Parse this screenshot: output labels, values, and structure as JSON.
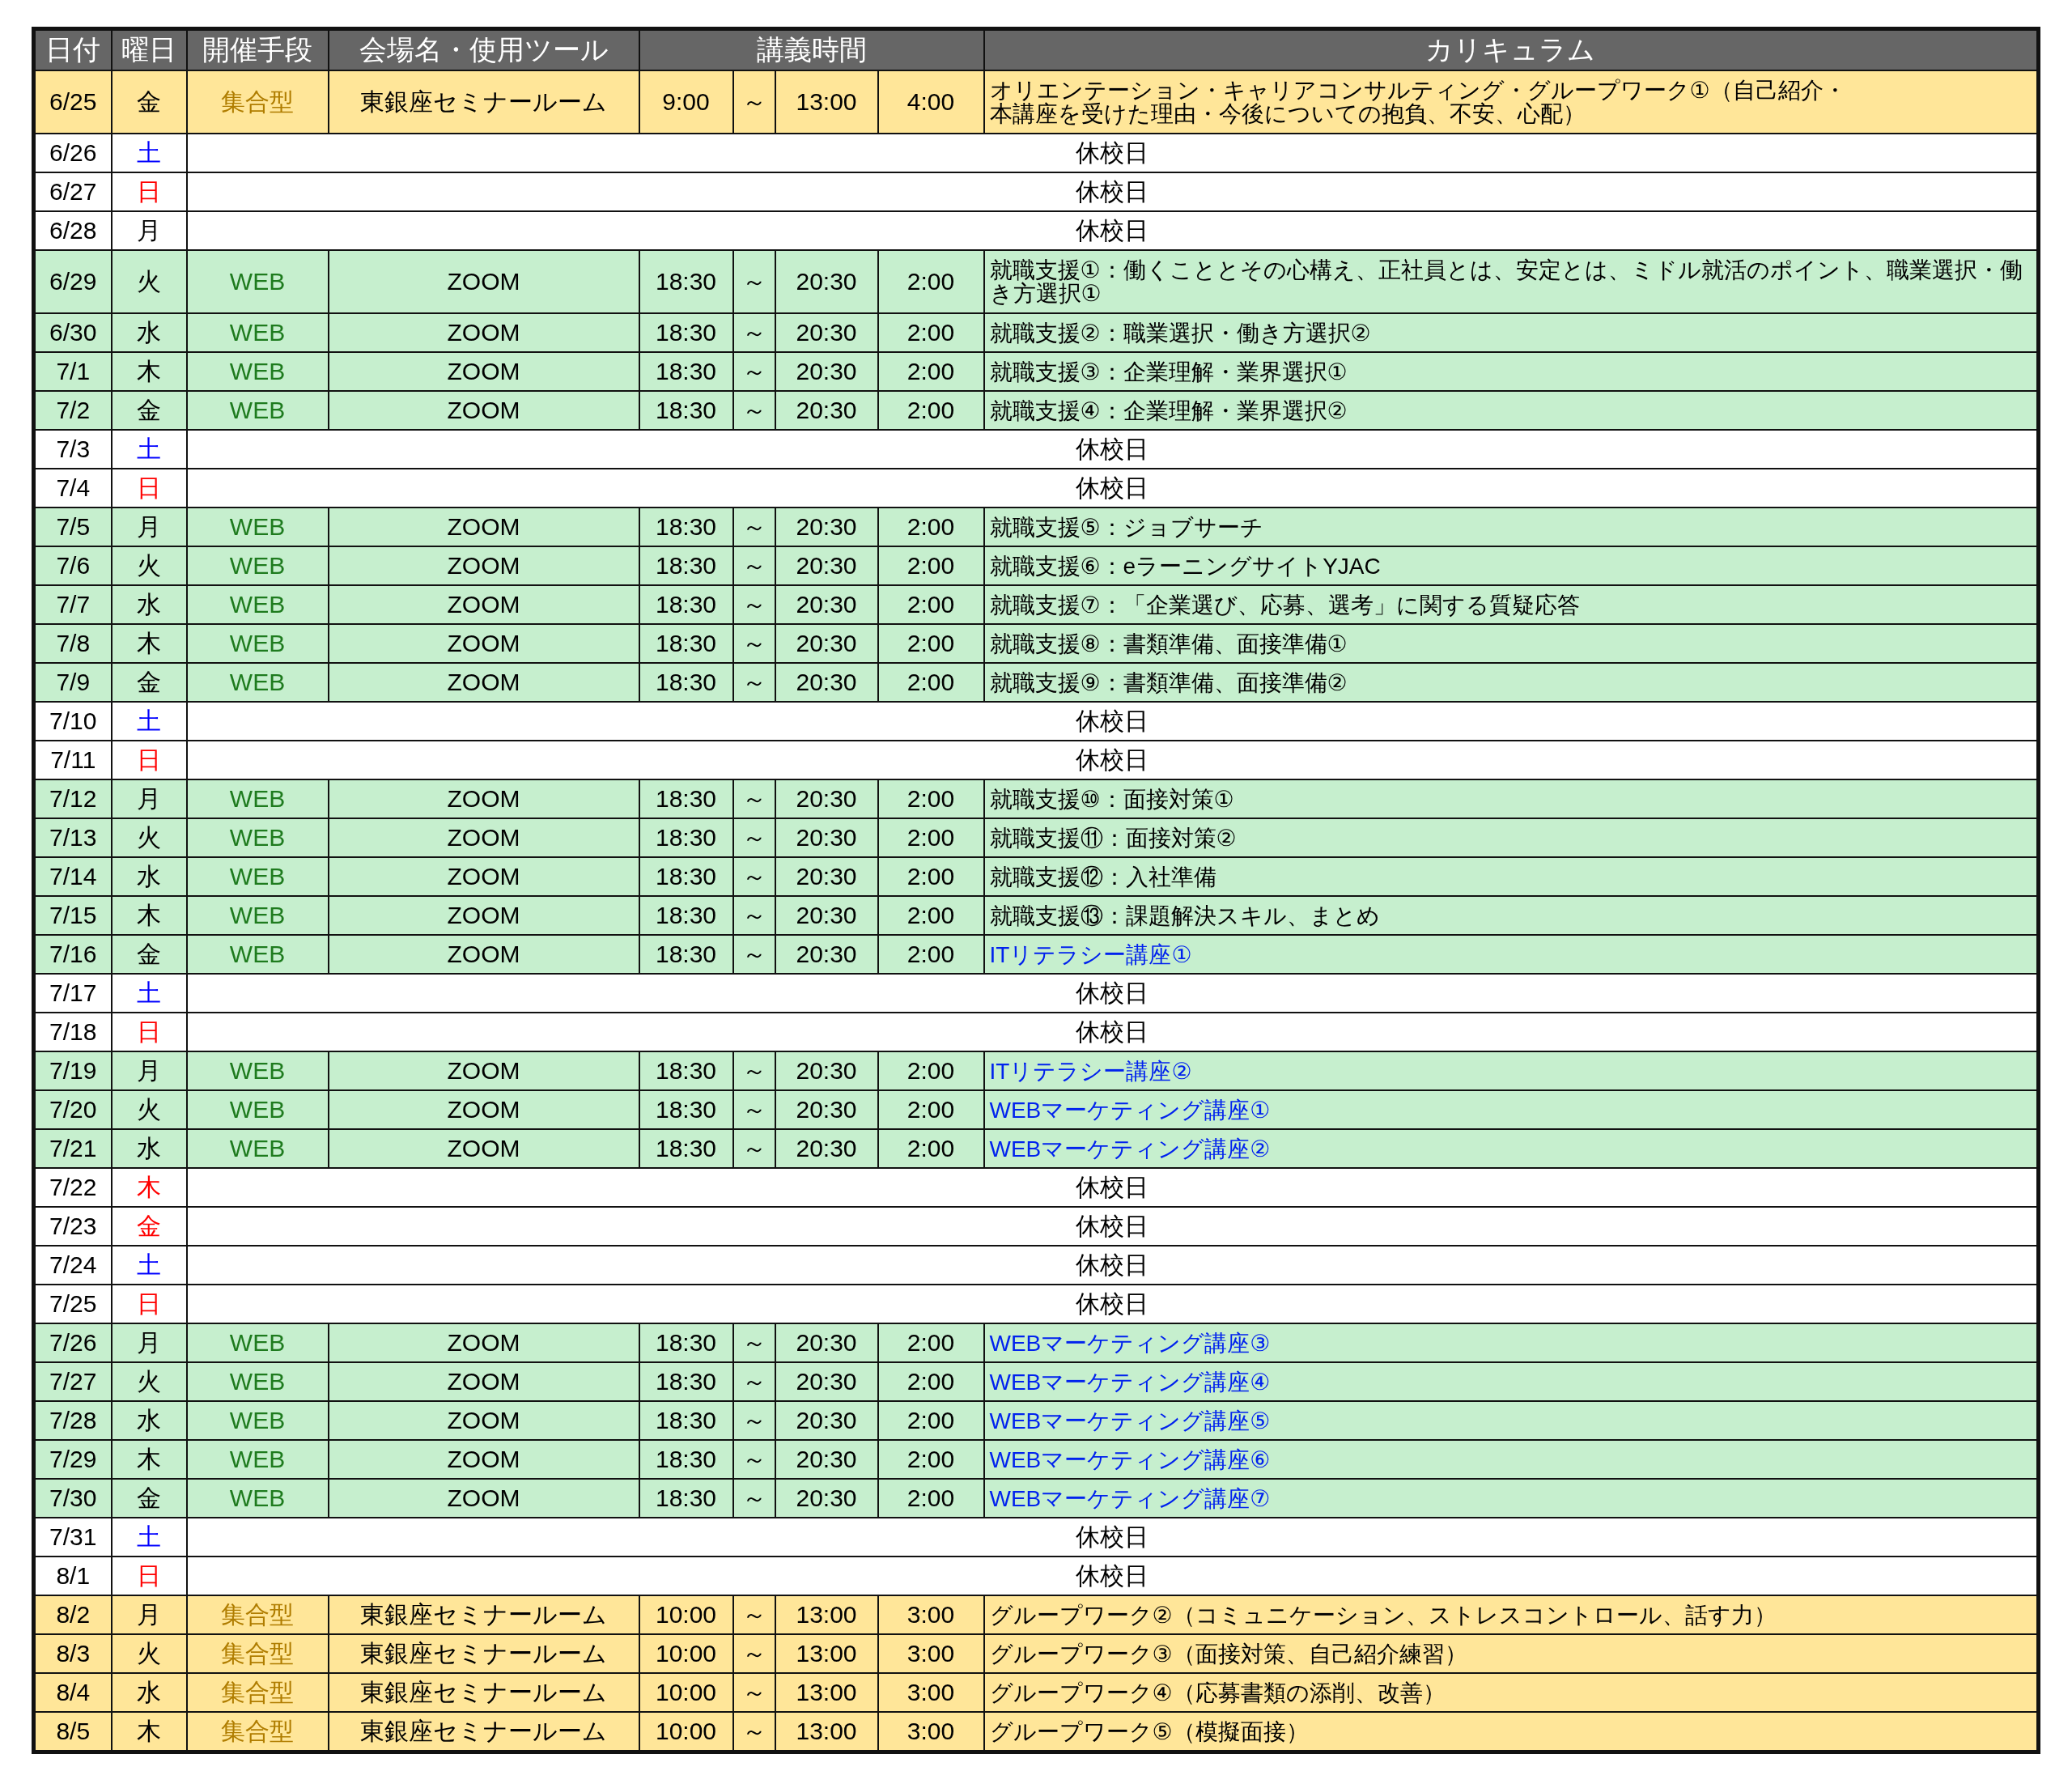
{
  "columns": [
    "日付",
    "曜日",
    "開催手段",
    "会場名・使用ツール",
    "講義時間",
    "カリキュラム"
  ],
  "rows": [
    {
      "kind": "onsite",
      "date": "6/25",
      "day": {
        "text": "金",
        "color": "#000000"
      },
      "mode": "集合型",
      "venue": "東銀座セミナールーム",
      "start": "9:00",
      "tilde": "～",
      "end": "13:00",
      "duration": "4:00",
      "curriculum": {
        "lines": [
          "オリエンテーション・キャリアコンサルティング・グループワーク①（自己紹介・",
          "本講座を受けた理由・今後についての抱負、不安、心配）"
        ],
        "color": "#000000"
      }
    },
    {
      "kind": "holiday",
      "date": "6/26",
      "day": {
        "text": "土",
        "color": "#0000ff"
      },
      "note": "休校日"
    },
    {
      "kind": "holiday",
      "date": "6/27",
      "day": {
        "text": "日",
        "color": "#ff0000"
      },
      "note": "休校日"
    },
    {
      "kind": "holiday",
      "date": "6/28",
      "day": {
        "text": "月",
        "color": "#000000"
      },
      "note": "休校日"
    },
    {
      "kind": "web",
      "date": "6/29",
      "day": {
        "text": "火",
        "color": "#000000"
      },
      "mode": "WEB",
      "venue": "ZOOM",
      "start": "18:30",
      "tilde": "～",
      "end": "20:30",
      "duration": "2:00",
      "curriculum": {
        "lines": [
          "就職支援①：働くこととその心構え、正社員とは、安定とは、ミドル就活のポイント、職業選択・働",
          "き方選択①"
        ],
        "color": "#000000"
      }
    },
    {
      "kind": "web",
      "date": "6/30",
      "day": {
        "text": "水",
        "color": "#000000"
      },
      "mode": "WEB",
      "venue": "ZOOM",
      "start": "18:30",
      "tilde": "～",
      "end": "20:30",
      "duration": "2:00",
      "curriculum": {
        "lines": [
          "就職支援②：職業選択・働き方選択②"
        ],
        "color": "#000000"
      }
    },
    {
      "kind": "web",
      "date": "7/1",
      "day": {
        "text": "木",
        "color": "#000000"
      },
      "mode": "WEB",
      "venue": "ZOOM",
      "start": "18:30",
      "tilde": "～",
      "end": "20:30",
      "duration": "2:00",
      "curriculum": {
        "lines": [
          "就職支援③：企業理解・業界選択①"
        ],
        "color": "#000000"
      }
    },
    {
      "kind": "web",
      "date": "7/2",
      "day": {
        "text": "金",
        "color": "#000000"
      },
      "mode": "WEB",
      "venue": "ZOOM",
      "start": "18:30",
      "tilde": "～",
      "end": "20:30",
      "duration": "2:00",
      "curriculum": {
        "lines": [
          "就職支援④：企業理解・業界選択②"
        ],
        "color": "#000000"
      }
    },
    {
      "kind": "holiday",
      "date": "7/3",
      "day": {
        "text": "土",
        "color": "#0000ff"
      },
      "note": "休校日"
    },
    {
      "kind": "holiday",
      "date": "7/4",
      "day": {
        "text": "日",
        "color": "#ff0000"
      },
      "note": "休校日"
    },
    {
      "kind": "web",
      "date": "7/5",
      "day": {
        "text": "月",
        "color": "#000000"
      },
      "mode": "WEB",
      "venue": "ZOOM",
      "start": "18:30",
      "tilde": "～",
      "end": "20:30",
      "duration": "2:00",
      "curriculum": {
        "lines": [
          "就職支援⑤：ジョブサーチ"
        ],
        "color": "#000000"
      }
    },
    {
      "kind": "web",
      "date": "7/6",
      "day": {
        "text": "火",
        "color": "#000000"
      },
      "mode": "WEB",
      "venue": "ZOOM",
      "start": "18:30",
      "tilde": "～",
      "end": "20:30",
      "duration": "2:00",
      "curriculum": {
        "lines": [
          "就職支援⑥：eラーニングサイトYJAC"
        ],
        "color": "#000000"
      }
    },
    {
      "kind": "web",
      "date": "7/7",
      "day": {
        "text": "水",
        "color": "#000000"
      },
      "mode": "WEB",
      "venue": "ZOOM",
      "start": "18:30",
      "tilde": "～",
      "end": "20:30",
      "duration": "2:00",
      "curriculum": {
        "lines": [
          "就職支援⑦：「企業選び、応募、選考」に関する質疑応答"
        ],
        "color": "#000000"
      }
    },
    {
      "kind": "web",
      "date": "7/8",
      "day": {
        "text": "木",
        "color": "#000000"
      },
      "mode": "WEB",
      "venue": "ZOOM",
      "start": "18:30",
      "tilde": "～",
      "end": "20:30",
      "duration": "2:00",
      "curriculum": {
        "lines": [
          "就職支援⑧：書類準備、面接準備①"
        ],
        "color": "#000000"
      }
    },
    {
      "kind": "web",
      "date": "7/9",
      "day": {
        "text": "金",
        "color": "#000000"
      },
      "mode": "WEB",
      "venue": "ZOOM",
      "start": "18:30",
      "tilde": "～",
      "end": "20:30",
      "duration": "2:00",
      "curriculum": {
        "lines": [
          "就職支援⑨：書類準備、面接準備②"
        ],
        "color": "#000000"
      }
    },
    {
      "kind": "holiday",
      "date": "7/10",
      "day": {
        "text": "土",
        "color": "#0000ff"
      },
      "note": "休校日"
    },
    {
      "kind": "holiday",
      "date": "7/11",
      "day": {
        "text": "日",
        "color": "#ff0000"
      },
      "note": "休校日"
    },
    {
      "kind": "web",
      "date": "7/12",
      "day": {
        "text": "月",
        "color": "#000000"
      },
      "mode": "WEB",
      "venue": "ZOOM",
      "start": "18:30",
      "tilde": "～",
      "end": "20:30",
      "duration": "2:00",
      "curriculum": {
        "lines": [
          "就職支援⑩：面接対策①"
        ],
        "color": "#000000"
      }
    },
    {
      "kind": "web",
      "date": "7/13",
      "day": {
        "text": "火",
        "color": "#000000"
      },
      "mode": "WEB",
      "venue": "ZOOM",
      "start": "18:30",
      "tilde": "～",
      "end": "20:30",
      "duration": "2:00",
      "curriculum": {
        "lines": [
          "就職支援⑪：面接対策②"
        ],
        "color": "#000000"
      }
    },
    {
      "kind": "web",
      "date": "7/14",
      "day": {
        "text": "水",
        "color": "#000000"
      },
      "mode": "WEB",
      "venue": "ZOOM",
      "start": "18:30",
      "tilde": "～",
      "end": "20:30",
      "duration": "2:00",
      "curriculum": {
        "lines": [
          "就職支援⑫：入社準備"
        ],
        "color": "#000000"
      }
    },
    {
      "kind": "web",
      "date": "7/15",
      "day": {
        "text": "木",
        "color": "#000000"
      },
      "mode": "WEB",
      "venue": "ZOOM",
      "start": "18:30",
      "tilde": "～",
      "end": "20:30",
      "duration": "2:00",
      "curriculum": {
        "lines": [
          "就職支援⑬：課題解決スキル、まとめ"
        ],
        "color": "#000000"
      }
    },
    {
      "kind": "web",
      "date": "7/16",
      "day": {
        "text": "金",
        "color": "#000000"
      },
      "mode": "WEB",
      "venue": "ZOOM",
      "start": "18:30",
      "tilde": "～",
      "end": "20:30",
      "duration": "2:00",
      "curriculum": {
        "lines": [
          "ITリテラシー講座①"
        ],
        "color": "#0022ee"
      }
    },
    {
      "kind": "holiday",
      "date": "7/17",
      "day": {
        "text": "土",
        "color": "#0000ff"
      },
      "note": "休校日"
    },
    {
      "kind": "holiday",
      "date": "7/18",
      "day": {
        "text": "日",
        "color": "#ff0000"
      },
      "note": "休校日"
    },
    {
      "kind": "web",
      "date": "7/19",
      "day": {
        "text": "月",
        "color": "#000000"
      },
      "mode": "WEB",
      "venue": "ZOOM",
      "start": "18:30",
      "tilde": "～",
      "end": "20:30",
      "duration": "2:00",
      "curriculum": {
        "lines": [
          "ITリテラシー講座②"
        ],
        "color": "#0022ee"
      }
    },
    {
      "kind": "web",
      "date": "7/20",
      "day": {
        "text": "火",
        "color": "#000000"
      },
      "mode": "WEB",
      "venue": "ZOOM",
      "start": "18:30",
      "tilde": "～",
      "end": "20:30",
      "duration": "2:00",
      "curriculum": {
        "lines": [
          "WEBマーケティング講座①"
        ],
        "color": "#0022ee"
      }
    },
    {
      "kind": "web",
      "date": "7/21",
      "day": {
        "text": "水",
        "color": "#000000"
      },
      "mode": "WEB",
      "venue": "ZOOM",
      "start": "18:30",
      "tilde": "～",
      "end": "20:30",
      "duration": "2:00",
      "curriculum": {
        "lines": [
          "WEBマーケティング講座②"
        ],
        "color": "#0022ee"
      }
    },
    {
      "kind": "holiday",
      "date": "7/22",
      "day": {
        "text": "木",
        "color": "#ff0000"
      },
      "note": "休校日"
    },
    {
      "kind": "holiday",
      "date": "7/23",
      "day": {
        "text": "金",
        "color": "#ff0000"
      },
      "note": "休校日"
    },
    {
      "kind": "holiday",
      "date": "7/24",
      "day": {
        "text": "土",
        "color": "#0000ff"
      },
      "note": "休校日"
    },
    {
      "kind": "holiday",
      "date": "7/25",
      "day": {
        "text": "日",
        "color": "#ff0000"
      },
      "note": "休校日"
    },
    {
      "kind": "web",
      "date": "7/26",
      "day": {
        "text": "月",
        "color": "#000000"
      },
      "mode": "WEB",
      "venue": "ZOOM",
      "start": "18:30",
      "tilde": "～",
      "end": "20:30",
      "duration": "2:00",
      "curriculum": {
        "lines": [
          "WEBマーケティング講座③"
        ],
        "color": "#0022ee"
      }
    },
    {
      "kind": "web",
      "date": "7/27",
      "day": {
        "text": "火",
        "color": "#000000"
      },
      "mode": "WEB",
      "venue": "ZOOM",
      "start": "18:30",
      "tilde": "～",
      "end": "20:30",
      "duration": "2:00",
      "curriculum": {
        "lines": [
          "WEBマーケティング講座④"
        ],
        "color": "#0022ee"
      }
    },
    {
      "kind": "web",
      "date": "7/28",
      "day": {
        "text": "水",
        "color": "#000000"
      },
      "mode": "WEB",
      "venue": "ZOOM",
      "start": "18:30",
      "tilde": "～",
      "end": "20:30",
      "duration": "2:00",
      "curriculum": {
        "lines": [
          "WEBマーケティング講座⑤"
        ],
        "color": "#0022ee"
      }
    },
    {
      "kind": "web",
      "date": "7/29",
      "day": {
        "text": "木",
        "color": "#000000"
      },
      "mode": "WEB",
      "venue": "ZOOM",
      "start": "18:30",
      "tilde": "～",
      "end": "20:30",
      "duration": "2:00",
      "curriculum": {
        "lines": [
          "WEBマーケティング講座⑥"
        ],
        "color": "#0022ee"
      }
    },
    {
      "kind": "web",
      "date": "7/30",
      "day": {
        "text": "金",
        "color": "#000000"
      },
      "mode": "WEB",
      "venue": "ZOOM",
      "start": "18:30",
      "tilde": "～",
      "end": "20:30",
      "duration": "2:00",
      "curriculum": {
        "lines": [
          "WEBマーケティング講座⑦"
        ],
        "color": "#0022ee"
      }
    },
    {
      "kind": "holiday",
      "date": "7/31",
      "day": {
        "text": "土",
        "color": "#0000ff"
      },
      "note": "休校日"
    },
    {
      "kind": "holiday",
      "date": "8/1",
      "day": {
        "text": "日",
        "color": "#ff0000"
      },
      "note": "休校日"
    },
    {
      "kind": "onsite",
      "date": "8/2",
      "day": {
        "text": "月",
        "color": "#000000"
      },
      "mode": "集合型",
      "venue": "東銀座セミナールーム",
      "start": "10:00",
      "tilde": "～",
      "end": "13:00",
      "duration": "3:00",
      "curriculum": {
        "lines": [
          "グループワーク②（コミュニケーション、ストレスコントロール、話す力）"
        ],
        "color": "#000000"
      }
    },
    {
      "kind": "onsite",
      "date": "8/3",
      "day": {
        "text": "火",
        "color": "#000000"
      },
      "mode": "集合型",
      "venue": "東銀座セミナールーム",
      "start": "10:00",
      "tilde": "～",
      "end": "13:00",
      "duration": "3:00",
      "curriculum": {
        "lines": [
          "グループワーク③（面接対策、自己紹介練習）"
        ],
        "color": "#000000"
      }
    },
    {
      "kind": "onsite",
      "date": "8/4",
      "day": {
        "text": "水",
        "color": "#000000"
      },
      "mode": "集合型",
      "venue": "東銀座セミナールーム",
      "start": "10:00",
      "tilde": "～",
      "end": "13:00",
      "duration": "3:00",
      "curriculum": {
        "lines": [
          "グループワーク④（応募書類の添削、改善）"
        ],
        "color": "#000000"
      }
    },
    {
      "kind": "onsite",
      "date": "8/5",
      "day": {
        "text": "木",
        "color": "#000000"
      },
      "mode": "集合型",
      "venue": "東銀座セミナールーム",
      "start": "10:00",
      "tilde": "～",
      "end": "13:00",
      "duration": "3:00",
      "curriculum": {
        "lines": [
          "グループワーク⑤（模擬面接）"
        ],
        "color": "#000000"
      }
    }
  ]
}
